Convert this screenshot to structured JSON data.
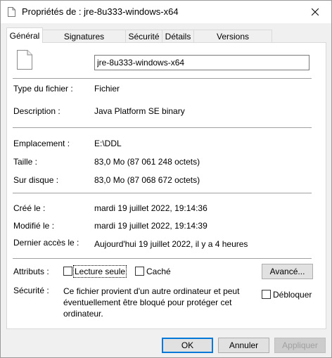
{
  "window": {
    "title": "Propriétés de : jre-8u333-windows-x64",
    "close_icon": "close-icon"
  },
  "tabs": [
    {
      "label": "Général",
      "active": true
    },
    {
      "label": "Signatures numériques",
      "active": false
    },
    {
      "label": "Sécurité",
      "active": false
    },
    {
      "label": "Détails",
      "active": false
    },
    {
      "label": "Versions précédentes",
      "active": false
    }
  ],
  "general": {
    "file_name": "jre-8u333-windows-x64",
    "type_label": "Type du fichier :",
    "type_value": "Fichier",
    "description_label": "Description :",
    "description_value": "Java Platform SE binary",
    "location_label": "Emplacement :",
    "location_value": "E:\\DDL",
    "size_label": "Taille :",
    "size_value": "83,0 Mo (87 061 248 octets)",
    "disk_label": "Sur disque :",
    "disk_value": "83,0 Mo (87 068 672 octets)",
    "created_label": "Créé le :",
    "created_value": "mardi 19 juillet 2022, 19:14:36",
    "modified_label": "Modifié le :",
    "modified_value": "mardi 19 juillet 2022, 19:14:39",
    "accessed_label": "Dernier accès le :",
    "accessed_value": "Aujourd'hui 19 juillet 2022, il y a 4 heures",
    "attributes_label": "Attributs :",
    "readonly_label": "Lecture seule",
    "readonly_checked": false,
    "hidden_label": "Caché",
    "hidden_checked": false,
    "advanced_button": "Avancé...",
    "security_label": "Sécurité :",
    "security_text": "Ce fichier provient d'un autre ordinateur et peut éventuellement être bloqué pour protéger cet ordinateur.",
    "unblock_label": "Débloquer",
    "unblock_checked": false
  },
  "buttons": {
    "ok": "OK",
    "cancel": "Annuler",
    "apply": "Appliquer"
  },
  "colors": {
    "accent": "#0078d7"
  }
}
